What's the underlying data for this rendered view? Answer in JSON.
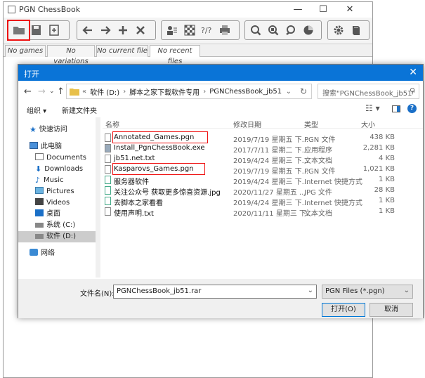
{
  "app": {
    "title": "PGN ChessBook",
    "controls": {
      "minimize": "—",
      "maximize": "☐",
      "close": "✕"
    }
  },
  "toolbar": {
    "groups": [
      [
        "open-folder",
        "save-disk",
        "new-file"
      ],
      [
        "back",
        "forward",
        "add",
        "delete"
      ],
      [
        "players",
        "board",
        "questions",
        "print"
      ],
      [
        "search",
        "search-board",
        "search-next",
        "chart"
      ],
      [
        "settings",
        "book"
      ]
    ]
  },
  "tabs": [
    "No games",
    "No variations",
    "No current file",
    "No recent files"
  ],
  "dialog": {
    "title": "打开",
    "close": "✕",
    "breadcrumb": [
      "«",
      "软件 (D:)",
      "›",
      "脚本之家下载软件专用",
      "›",
      "PGNChessBook_jb51"
    ],
    "search_placeholder": "搜索\"PGNChessBook_jb51\"",
    "organize": "组织 ▾",
    "new_folder": "新建文件夹",
    "sidebar": [
      {
        "label": "快速访问",
        "icon": "star-icon"
      },
      {
        "label": "此电脑",
        "icon": "computer-icon"
      },
      {
        "label": "Documents",
        "icon": "documents-icon"
      },
      {
        "label": "Downloads",
        "icon": "downloads-icon"
      },
      {
        "label": "Music",
        "icon": "music-icon"
      },
      {
        "label": "Pictures",
        "icon": "pictures-icon"
      },
      {
        "label": "Videos",
        "icon": "videos-icon"
      },
      {
        "label": "桌面",
        "icon": "desktop-icon"
      },
      {
        "label": "系统 (C:)",
        "icon": "drive-icon"
      },
      {
        "label": "软件 (D:)",
        "icon": "drive-icon"
      },
      {
        "label": "网络",
        "icon": "network-icon"
      }
    ],
    "columns": {
      "name": "名称",
      "date": "修改日期",
      "type": "类型",
      "size": "大小"
    },
    "files": [
      {
        "name": "Annotated_Games.pgn",
        "date": "2019/7/19 星期五 下...",
        "type": "PGN 文件",
        "size": "438 KB"
      },
      {
        "name": "Install_PgnChessBook.exe",
        "date": "2017/7/11 星期二 下...",
        "type": "应用程序",
        "size": "2,281 KB"
      },
      {
        "name": "jb51.net.txt",
        "date": "2019/4/24 星期三 下...",
        "type": "文本文档",
        "size": "4 KB"
      },
      {
        "name": "Kasparovs_Games.pgn",
        "date": "2019/7/19 星期五 下...",
        "type": "PGN 文件",
        "size": "1,021 KB"
      },
      {
        "name": "服务器软件",
        "date": "2019/4/24 星期三 下...",
        "type": "Internet 快捷方式",
        "size": "1 KB"
      },
      {
        "name": "关注公众号 获取更多惊喜资源.jpg",
        "date": "2020/11/27 星期五 ...",
        "type": "JPG 文件",
        "size": "28 KB"
      },
      {
        "name": "去脚本之家看看",
        "date": "2019/4/24 星期三 下...",
        "type": "Internet 快捷方式",
        "size": "1 KB"
      },
      {
        "name": "使用声明.txt",
        "date": "2020/11/11 星期三 下...",
        "type": "文本文档",
        "size": "1 KB"
      }
    ],
    "filename_label": "文件名(N):",
    "filename_value": "PGNChessBook_jb51.rar",
    "filetype": "PGN Files  (*.pgn)",
    "open_button": "打开(O)",
    "cancel_button": "取消"
  }
}
